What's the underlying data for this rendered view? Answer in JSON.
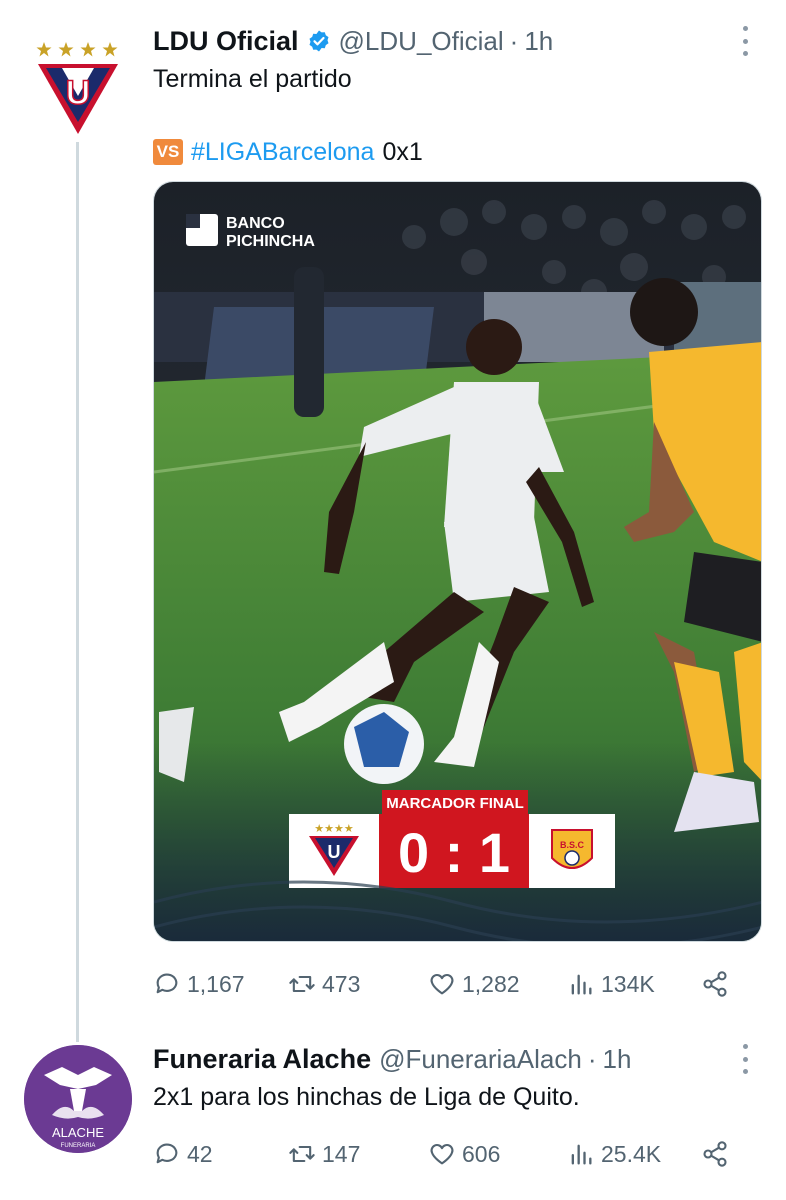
{
  "tweet1": {
    "name": "LDU Oficial",
    "handle": "@LDU_Oficial",
    "separator": "·",
    "time": "1h",
    "text_line1": "Termina el partido",
    "vs_label": "VS",
    "hashtag": "#LIGABarcelona",
    "score": "0x1",
    "media": {
      "sponsor_line1": "BANCO",
      "sponsor_line2": "PICHINCHA",
      "banner_label": "MARCADOR FINAL",
      "score": "0 : 1",
      "home_stars": "★★★★",
      "home_crest_letter": "U",
      "away_crest_text": "B.S.C"
    },
    "actions": {
      "replies": "1,167",
      "retweets": "473",
      "likes": "1,282",
      "views": "134K"
    }
  },
  "tweet2": {
    "name": "Funeraria Alache",
    "handle": "@FunerariaAlach",
    "separator": "·",
    "time": "1h",
    "text": "2x1 para los hinchas de Liga de Quito.",
    "avatar_label": "ALACHE",
    "avatar_sub": "FUNERARIA",
    "actions": {
      "replies": "42",
      "retweets": "147",
      "likes": "606",
      "views": "25.4K"
    }
  },
  "colors": {
    "accent": "#1d9bf0",
    "muted": "#536471",
    "ldu_red": "#c8102e",
    "ldu_navy": "#1b2a6b",
    "bsc_yellow": "#f5b82e",
    "alache_purple": "#6b3a93"
  },
  "icons": [
    "verified-badge-icon",
    "more-icon",
    "reply-icon",
    "retweet-icon",
    "like-icon",
    "views-icon",
    "share-icon"
  ]
}
